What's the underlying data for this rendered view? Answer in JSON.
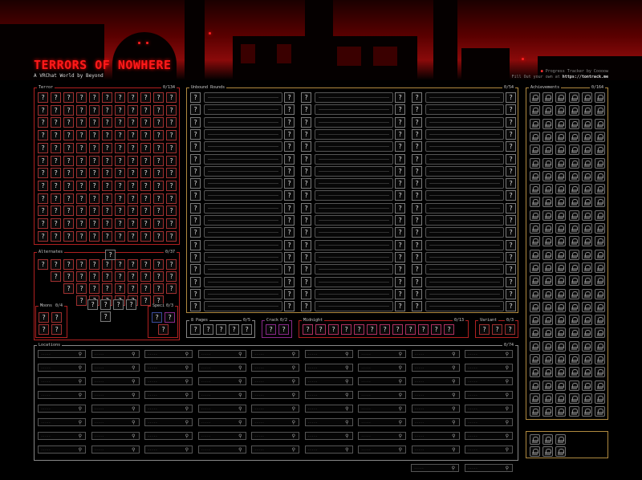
{
  "header": {
    "title": "TERRORS OF NOWHERE",
    "subtitle": "A VRChat World by Beyond",
    "credit_line1": "Progress Tracker by Coooow",
    "credit_prefix": "Fill Out your own at",
    "credit_url": "https://tontrack.me"
  },
  "terrors": {
    "label": "Terror",
    "count": "0/134"
  },
  "unbound": {
    "label": "Unbound Rounds",
    "count": "0/54"
  },
  "achievements": {
    "label": "Achievements",
    "count": "0/164"
  },
  "alternates": {
    "label": "Alternates",
    "count": "0/37"
  },
  "moons": {
    "label": "Moons",
    "count": "0/4"
  },
  "special": {
    "label": "Special",
    "count": "0/3"
  },
  "eight_pages": {
    "label": "8 Pages",
    "count": "0/5"
  },
  "cracked": {
    "label": "Cracked",
    "count": "0/2"
  },
  "midnight": {
    "label": "Midnight",
    "count": "0/13"
  },
  "variant": {
    "label": "Variant",
    "count": "0/3"
  },
  "locations": {
    "label": "Locations",
    "count": "0/74",
    "placeholder": "-----"
  },
  "unknown_glyph": "?",
  "colors": {
    "accent": "#ff1a1a",
    "border_red": "#b02020",
    "border_gold": "#b08a40",
    "border_grey": "#888888",
    "border_purple": "#8a2a8a"
  }
}
